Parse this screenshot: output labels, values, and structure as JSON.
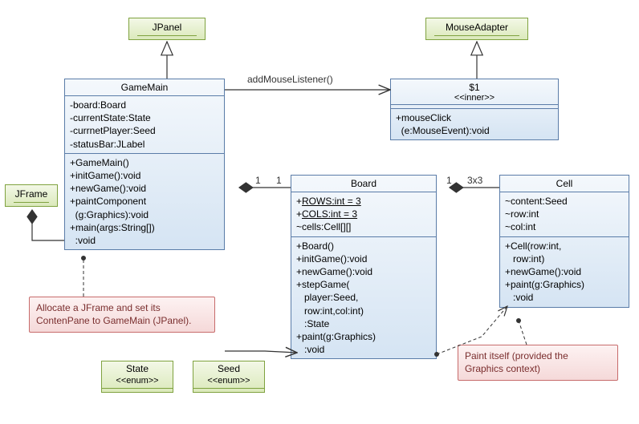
{
  "interfaces": {
    "jpanel": "JPanel",
    "mouseadapter": "MouseAdapter",
    "jframe": "JFrame"
  },
  "enums": {
    "state_name": "State",
    "state_st": "<<enum>>",
    "seed_name": "Seed",
    "seed_st": "<<enum>>"
  },
  "gamemain": {
    "title": "GameMain",
    "a1": "-board:Board",
    "a2": "-currentState:State",
    "a3": "-currnetPlayer:Seed",
    "a4": "-statusBar:JLabel",
    "m1": "+GameMain()",
    "m2": "+initGame():void",
    "m3": "+newGame():void",
    "m4a": "+paintComponent",
    "m4b": "  (g:Graphics):void",
    "m5a": "+main(args:String[])",
    "m5b": "  :void"
  },
  "inner": {
    "title": "$1",
    "stereo": "<<inner>>",
    "m1a": "+mouseClick",
    "m1b": "  (e:MouseEvent):void"
  },
  "board": {
    "title": "Board",
    "a1": "+ROWS:int = 3",
    "a2": "+COLS:int = 3",
    "a3": "~cells:Cell[][]",
    "m1": "+Board()",
    "m2": "+initGame():void",
    "m3": "+newGame():void",
    "m4a": "+stepGame(",
    "m4b": "   player:Seed,",
    "m4c": "   row:int,col:int)",
    "m4d": "   :State",
    "m5a": "+paint(g:Graphics)",
    "m5b": "   :void"
  },
  "cell": {
    "title": "Cell",
    "a1": "~content:Seed",
    "a2": "~row:int",
    "a3": "~col:int",
    "m1a": "+Cell(row:int,",
    "m1b": "   row:int)",
    "m2": "+newGame():void",
    "m3a": "+paint(g:Graphics)",
    "m3b": "   :void"
  },
  "labels": {
    "addMouse": "addMouseListener()",
    "one_l": "1",
    "one_r": "1",
    "one_a": "1",
    "threeby": "3x3"
  },
  "notes": {
    "n1a": "Allocate a JFrame and set its",
    "n1b": "ContenPane to GameMain (JPanel).",
    "n2a": "Paint itself (provided the",
    "n2b": "Graphics context)"
  }
}
